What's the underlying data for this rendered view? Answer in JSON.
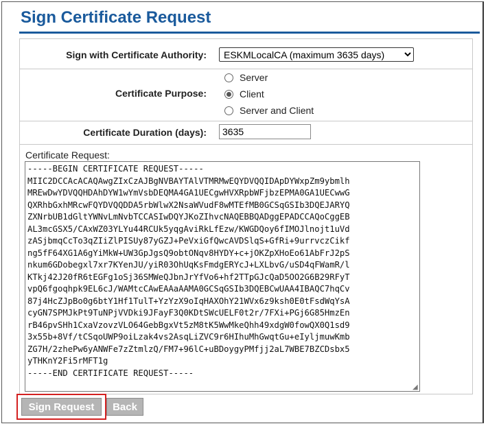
{
  "page": {
    "title": "Sign Certificate Request"
  },
  "form": {
    "ca_label": "Sign with Certificate Authority:",
    "ca_selected": "ESKMLocalCA (maximum 3635 days)",
    "purpose_label": "Certificate Purpose:",
    "purpose_options": [
      {
        "label": "Server",
        "checked": false
      },
      {
        "label": "Client",
        "checked": true
      },
      {
        "label": "Server and Client",
        "checked": false
      }
    ],
    "duration_label": "Certificate Duration (days):",
    "duration_value": "3635",
    "request_label": "Certificate Request:",
    "request_text": "-----BEGIN CERTIFICATE REQUEST-----\nMIIC2DCCAcACAQAwgZIxCzAJBgNVBAYTAlVTMRMwEQYDVQQIDApDYWxpZm9ybmlh\nMREwDwYDVQQHDAhDYW1wYmVsbDEQMA4GA1UECgwHVXRpbWFjbzEPMA0GA1UECwwG\nQXRhbGxhMRcwFQYDVQQDDA5rbWlwX2NsaWVudF8wMTEfMB0GCSqGSIb3DQEJARYQ\nZXNrbUB1dGltYWNvLmNvbTCCASIwDQYJKoZIhvcNAQEBBQADggEPADCCAQoCggEB\nAL3mcGSX5/CAxWZ03YLYu44RCUk5yqgAviRkLfEzw/KWGDQoy6fIMOJlnojt1uVd\nzASjbmqCcTo3qZIiZlPISUy87yGZJ+PeVxiGfQwcAVDSlqS+GfRi+9urrvczCikf\nng5fF64XG1A6gYiMkW+UW3GpJgsQ9obtONqv8HYDY+c+jOKZpXHoEo61AbFrJ2pS\nnkum6GDobegxl7xr7KYenJU/yiR03OhUqKsFmdgERYcJ+LXLbvG/uSD4qFWamR/l\nKTkj42J20fR6tEGFg1oSj36SMWeQJbnJrYfVo6+hf2TTpGJcQaD5OO2G6B29RFyT\nvpQ6fgoqhpk9EL6cJ/WAMtcCAwEAAaAAMA0GCSqGSIb3DQEBCwUAA4IBAQC7hqCv\n87j4HcZJpBo0g6btY1Hf1TulT+YzYzX9oIqHAXOhY21WVx6z9ksh0E0tFsdWqYsA\ncyGN7SPMJkPt9TuNPjVVDki9JFayF3Q0KDtSWcUELF0t2r/7FXi+PGj6G85HmzEn\nrB46pvSHh1CxaVzovzVLO64GebBgxVt5zM8tK5WwMkeQhh49xdgW0fowQX0Q1sd9\n3x55b+8Vf/tCSqoUWP9oiLzak4vs2AsqLiZVC9r6HIhuMhGwqtGu+eIyljmuwKmb\nZG7H/2zhePw6yANWFe7zZtmlzQ/FM7+96lC+uBDoygyPMfjj2aL7WBE7BZCDsbx5\nyTHKnY2Fi5rMFT1g\n-----END CERTIFICATE REQUEST-----"
  },
  "buttons": {
    "sign_label": "Sign Request",
    "back_label": "Back"
  },
  "colors": {
    "title": "#1a5a9c",
    "highlight": "#d32020",
    "button_bg": "#b5b5b5"
  }
}
